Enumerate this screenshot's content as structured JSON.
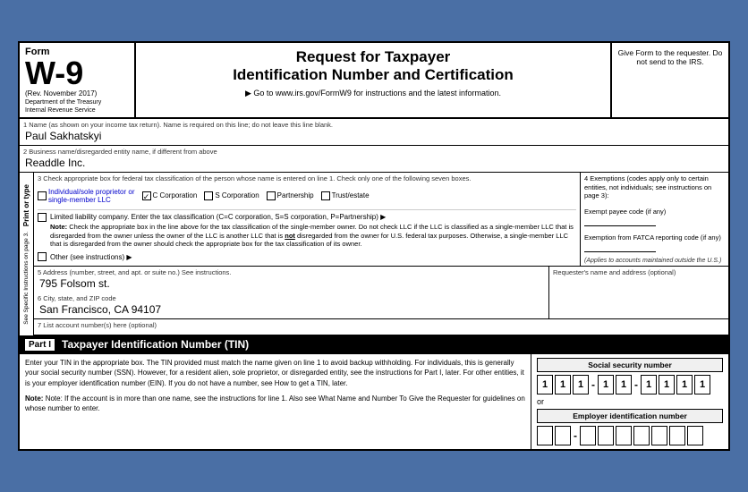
{
  "header": {
    "form_label": "Form",
    "form_number": "W-9",
    "rev_date": "(Rev. November 2017)",
    "dept1": "Department of the Treasury",
    "dept2": "Internal Revenue Service",
    "title_line1": "Request for Taxpayer",
    "title_line2": "Identification Number and Certification",
    "url_line": "▶ Go to www.irs.gov/FormW9 for instructions and the latest information.",
    "give_form": "Give Form to the requester. Do not send to the IRS."
  },
  "fields": {
    "line1_label": "1  Name (as shown on your income tax return). Name is required on this line; do not leave this line blank.",
    "line1_value": "Paul Sakhatskyi",
    "line2_label": "2  Business name/disregarded entity name, if different from above",
    "line2_value": "Readdle Inc.",
    "line3_label": "3  Check appropriate box for federal tax classification of the person whose name is entered on line 1. Check only one of the following seven boxes.",
    "exemptions_label": "4  Exemptions (codes apply only to certain entities, not individuals; see instructions on page 3):",
    "exempt_payee_label": "Exempt payee code (if any)",
    "fatca_label": "Exemption from FATCA reporting code (if any)",
    "fatca_note": "(Applies to accounts maintained outside the U.S.)",
    "tax_options": [
      {
        "id": "individual",
        "label": "Individual/sole proprietor or single-member LLC",
        "checked": false,
        "blue": true
      },
      {
        "id": "c_corp",
        "label": "C Corporation",
        "checked": true
      },
      {
        "id": "s_corp",
        "label": "S Corporation",
        "checked": false
      },
      {
        "id": "partnership",
        "label": "Partnership",
        "checked": false
      },
      {
        "id": "trust",
        "label": "Trust/estate",
        "checked": false
      }
    ],
    "llc_label": "Limited liability company. Enter the tax classification (C=C corporation, S=S corporation, P=Partnership) ▶",
    "llc_note": "Note: Check the appropriate box in the line above for the tax classification of the single-member owner. Do not check LLC if the LLC is classified as a single-member LLC that is disregarded from the owner unless the owner of the LLC is another LLC that is not disregarded from the owner for U.S. federal tax purposes. Otherwise, a single-member LLC that is disregarded from the owner should check the appropriate box for the tax classification of its owner.",
    "other_label": "Other (see instructions) ▶",
    "line5_label": "5  Address (number, street, and apt. or suite no.) See instructions.",
    "line5_value": "795 Folsom st.",
    "requester_label": "Requester's name and address (optional)",
    "line6_label": "6  City, state, and ZIP code",
    "line6_value": "San Francisco, CA 94107",
    "line7_label": "7  List account number(s) here (optional)"
  },
  "side_labels": {
    "print": "Print or type",
    "specific": "See Specific Instructions on page 3."
  },
  "part1": {
    "label": "Part I",
    "title": "Taxpayer Identification Number (TIN)",
    "body_text": "Enter your TIN in the appropriate box. The TIN provided must match the name given on line 1 to avoid backup withholding. For individuals, this is generally your social security number (SSN). However, for a resident alien, sole proprietor, or disregarded entity, see the instructions for Part I, later. For other entities, it is your employer identification number (EIN). If you do not have a number, see How to get a TIN, later.",
    "note_text": "Note: If the account is in more than one name, see the instructions for line 1. Also see What Name and Number To Give the Requester for guidelines on whose number to enter.",
    "ssn_label": "Social security number",
    "ssn_digits": [
      "1",
      "1",
      "1",
      "1",
      "1",
      "1",
      "1",
      "1",
      "1"
    ],
    "or_text": "or",
    "ein_label": "Employer identification number",
    "ein_digits": [
      "",
      "",
      "",
      "",
      "",
      "",
      "",
      "",
      ""
    ]
  }
}
